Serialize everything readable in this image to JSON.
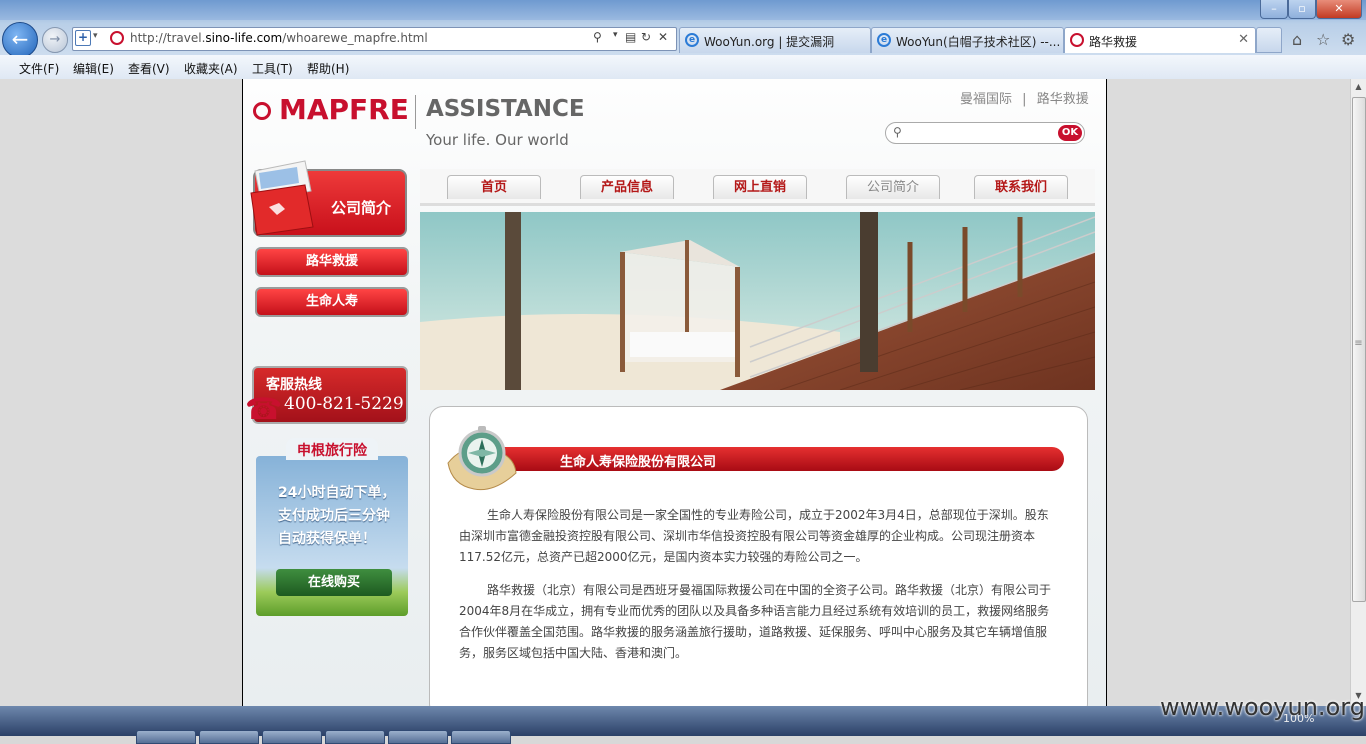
{
  "browser": {
    "address_url_prefix": "http://travel.",
    "address_url_domain": "sino-life.com",
    "address_url_path": "/whoarewe_mapfre.html",
    "tabs": [
      {
        "label": "WooYun.org | 提交漏洞"
      },
      {
        "label": "WooYun(白帽子技术社区) --..."
      },
      {
        "label": "路华救援"
      }
    ],
    "menu": [
      "文件(F)",
      "编辑(E)",
      "查看(V)",
      "收藏夹(A)",
      "工具(T)",
      "帮助(H)"
    ]
  },
  "site": {
    "logo_brand": "MAPFRE",
    "logo_assistance": "ASSISTANCE",
    "logo_tagline": "Your life. Our world",
    "toplinks": [
      "曼福国际",
      "路华救援"
    ],
    "toplink_sep": "|",
    "search_button": "OK",
    "side_card_label": "公司简介",
    "side_nav": [
      "路华救援",
      "生命人寿"
    ],
    "hotline_title": "客服热线",
    "hotline_number": "400-821-5229",
    "promo_tab": "申根旅行险",
    "promo_text": "24小时自动下单，支付成功后三分钟自动获得保单！",
    "promo_button": "在线购买",
    "main_nav": [
      "首页",
      "产品信息",
      "网上直销",
      "公司简介",
      "联系我们"
    ],
    "content_title": "生命人寿保险股份有限公司",
    "paragraphs": [
      "生命人寿保险股份有限公司是一家全国性的专业寿险公司，成立于2002年3月4日，总部现位于深圳。股东由深圳市富德金融投资控股有限公司、深圳市华信投资控股有限公司等资金雄厚的企业构成。公司现注册资本117.52亿元，总资产已超2000亿元，是国内资本实力较强的寿险公司之一。",
      "路华救援（北京）有限公司是西班牙曼福国际救援公司在中国的全资子公司。路华救援（北京）有限公司于2004年8月在华成立，拥有专业而优秀的团队以及具备多种语言能力且经过系统有效培训的员工，救援网络服务合作伙伴覆盖全国范围。路华救援的服务涵盖旅行援助，道路救援、延保服务、呼叫中心服务及其它车辆增值服务，服务区域包括中国大陆、香港和澳门。"
    ]
  },
  "status": {
    "zoom": "100%",
    "watermark": "www.wooyun.org"
  },
  "colors": {
    "brand_red": "#c8102e"
  }
}
